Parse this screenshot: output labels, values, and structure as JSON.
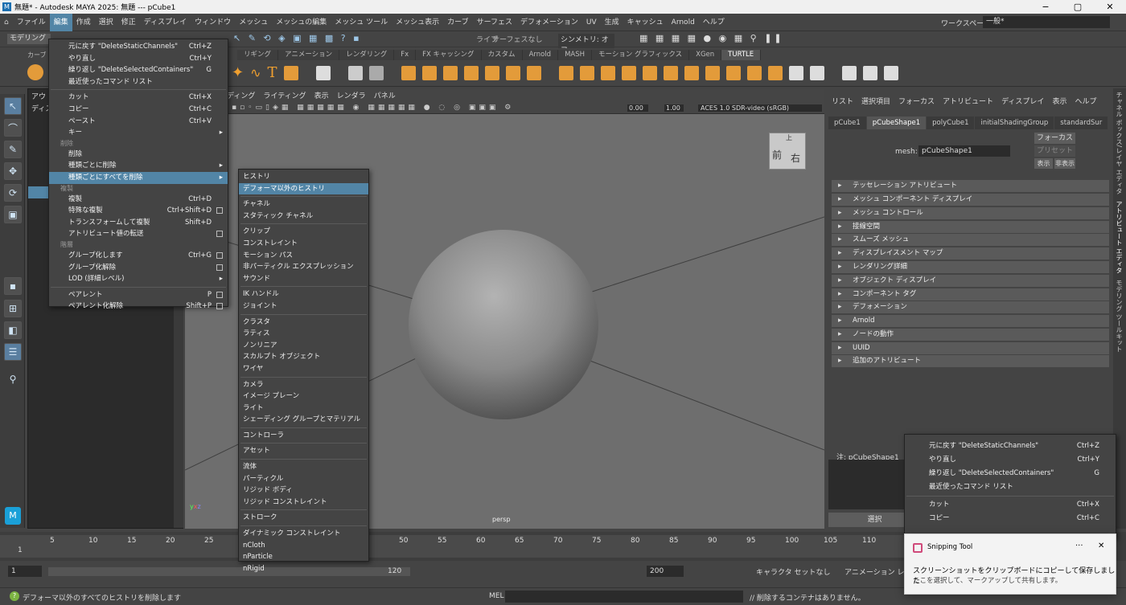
{
  "window": {
    "title": "無題* - Autodesk MAYA 2025: 無題   ---   pCube1"
  },
  "menubar": [
    "ファイル",
    "編集",
    "作成",
    "選択",
    "修正",
    "ディスプレイ",
    "ウィンドウ",
    "メッシュ",
    "メッシュの編集",
    "メッシュ ツール",
    "メッシュ表示",
    "カーブ",
    "サーフェス",
    "デフォメーション",
    "UV",
    "生成",
    "キャッシュ",
    "Arnold",
    "ヘルプ"
  ],
  "workspace": {
    "label": "ワークスペース:",
    "value": "一般*"
  },
  "row2": {
    "mode": "モデリング",
    "live": "ライブ",
    "surface": "サーフェスなし",
    "symmetry": "シンメトリ: オフ"
  },
  "shelf_tabs": [
    "リギング",
    "アニメーション",
    "レンダリング",
    "Fx",
    "FX キャッシング",
    "カスタム",
    "Arnold",
    "MASH",
    "モーション グラフィックス",
    "XGen",
    "TURTLE"
  ],
  "shelf_left_tab": "カーブ",
  "outliner": {
    "title": "アウ",
    "sub": "ディス"
  },
  "viewport": {
    "menus": [
      "ディング",
      "ライティング",
      "表示",
      "レンダラ",
      "パネル"
    ],
    "exposure": "0.00",
    "gamma": "1.00",
    "colorspace": "ACES 1.0 SDR-video (sRGB)",
    "camera": "persp",
    "cube_front": "前",
    "cube_right": "右",
    "cube_top": "上"
  },
  "edit_menu": {
    "undo": "元に戻す \"DeleteStaticChannels\"",
    "undo_sc": "Ctrl+Z",
    "redo": "やり直し",
    "redo_sc": "Ctrl+Y",
    "repeat": "繰り返し \"DeleteSelectedContainers\"",
    "repeat_sc": "G",
    "recent": "最近使ったコマンド リスト",
    "cut": "カット",
    "cut_sc": "Ctrl+X",
    "copy": "コピー",
    "copy_sc": "Ctrl+C",
    "paste": "ペースト",
    "paste_sc": "Ctrl+V",
    "keys": "キー",
    "hdr_delete": "削除",
    "delete": "削除",
    "delete_by_type": "種類ごとに削除",
    "delete_all_by_type": "種類ごとにすべてを削除",
    "hdr_dup": "複製",
    "duplicate": "複製",
    "duplicate_sc": "Ctrl+D",
    "dup_special": "特殊な複製",
    "dup_special_sc": "Ctrl+Shift+D",
    "dup_transform": "トランスフォームして複製",
    "dup_transform_sc": "Shift+D",
    "transfer": "アトリビュート値の転送",
    "hdr_hier": "階層",
    "group": "グループ化します",
    "group_sc": "Ctrl+G",
    "ungroup": "グループ化解除",
    "lod": "LOD (詳細レベル)",
    "parent": "ペアレント",
    "parent_sc": "P",
    "unparent": "ペアレント化解除",
    "unparent_sc": "Shift+P"
  },
  "sub_menu": [
    "ヒストリ",
    "デフォーマ以外のヒストリ",
    "|",
    "チャネル",
    "スタティック チャネル",
    "|",
    "クリップ",
    "コンストレイント",
    "モーション パス",
    "非パーティクル エクスプレッション",
    "サウンド",
    "|",
    "IK ハンドル",
    "ジョイント",
    "|",
    "クラスタ",
    "ラティス",
    "ノンリニア",
    "スカルプト オブジェクト",
    "ワイヤ",
    "|",
    "カメラ",
    "イメージ プレーン",
    "ライト",
    "シェーディング グループとマテリアル",
    "|",
    "コントローラ",
    "|",
    "アセット",
    "|",
    "流体",
    "パーティクル",
    "リジッド ボディ",
    "リジッド コンストレイント",
    "|",
    "ストローク",
    "|",
    "ダイナミック コンストレイント",
    "nCloth",
    "nParticle",
    "nRigid"
  ],
  "attr_editor": {
    "menus": [
      "リスト",
      "選択項目",
      "フォーカス",
      "アトリビュート",
      "ディスプレイ",
      "表示",
      "ヘルプ"
    ],
    "tabs": [
      "pCube1",
      "pCubeShape1",
      "polyCube1",
      "initialShadingGroup",
      "standardSur"
    ],
    "mesh_label": "mesh:",
    "mesh_value": "pCubeShape1",
    "focus": "フォーカス",
    "preset": "プリセット",
    "show": "表示",
    "hide": "非表示",
    "sections": [
      "テッセレーション アトリビュート",
      "メッシュ コンポーネント ディスプレイ",
      "メッシュ コントロール",
      "接線空間",
      "スムーズ メッシュ",
      "ディスプレイスメント マップ",
      "レンダリング詳細",
      "オブジェクト ディスプレイ",
      "コンポーネント タグ",
      "デフォメーション",
      "Arnold",
      "ノードの動作",
      "UUID",
      "追加のアトリビュート"
    ],
    "notes": "注: pCubeShape1",
    "select_btn": "選択"
  },
  "right_strip": [
    "チャネル ボックス/レイヤ エディタ",
    "アトリビュート エディタ",
    "モデリング ツールキット"
  ],
  "context_menu2": {
    "undo": "元に戻す \"DeleteStaticChannels\"",
    "undo_sc": "Ctrl+Z",
    "redo": "やり直し",
    "redo_sc": "Ctrl+Y",
    "repeat": "繰り返し \"DeleteSelectedContainers\"",
    "repeat_sc": "G",
    "recent": "最近使ったコマンド リスト",
    "cut": "カット",
    "cut_sc": "Ctrl+X",
    "copy": "コピー",
    "copy_sc": "Ctrl+C"
  },
  "timeline": {
    "ticks": [
      "1",
      "5",
      "10",
      "15",
      "20",
      "25",
      "50",
      "55",
      "60",
      "65",
      "70",
      "75",
      "80",
      "85",
      "90",
      "95",
      "100",
      "105",
      "110"
    ]
  },
  "range": {
    "start": "1",
    "start2": "1",
    "end": "120",
    "end2": "200",
    "charset": "キャラクタ セットなし",
    "animlayer": "アニメーション レイヤな"
  },
  "status": {
    "help": "デフォーマ以外のすべてのヒストリを削除します",
    "mel": "MEL",
    "result": "// 削除するコンテナはありません。"
  },
  "toast": {
    "app": "Snipping Tool",
    "msg": "スクリーンショットをクリップボードにコピーして保存しました",
    "sub": "ここを選択して、マークアップして共有します。"
  }
}
